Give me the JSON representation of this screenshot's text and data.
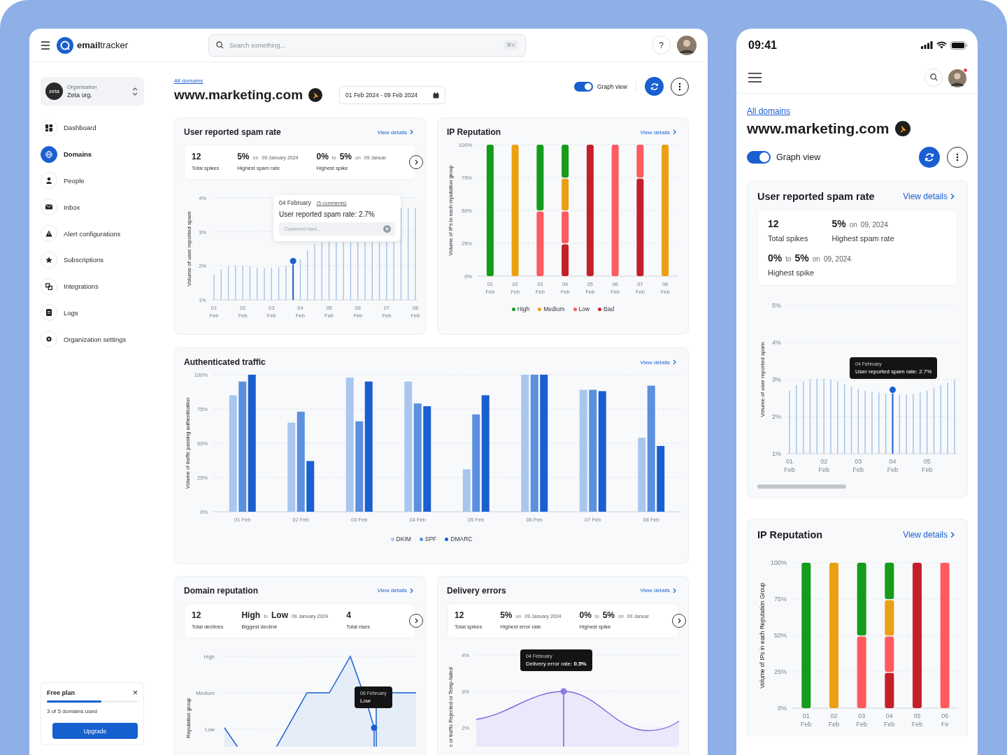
{
  "desktop": {
    "header": {
      "logo": "**email**tracker",
      "search": {
        "placeholder": "Search something...",
        "shortcut": "⌘K"
      },
      "help": "?"
    },
    "sidebar": {
      "org": {
        "badge": "zeta",
        "label": "Organisation",
        "name": "Zeta org."
      },
      "items": [
        {
          "kind": "dashboard",
          "label": "Dashboard",
          "selected": false
        },
        {
          "kind": "domains",
          "label": "Domains",
          "selected": true
        },
        {
          "kind": "people",
          "label": "People",
          "selected": false
        },
        {
          "kind": "inbox",
          "label": "Inbox",
          "selected": false
        },
        {
          "kind": "alerts",
          "label": "Alert configurations",
          "selected": false
        },
        {
          "kind": "subscriptions",
          "label": "Subscriptions",
          "selected": false
        },
        {
          "kind": "integrations",
          "label": "Integrations",
          "selected": false
        },
        {
          "kind": "logs",
          "label": "Logs",
          "selected": false
        },
        {
          "kind": "settings",
          "label": "Organization settings",
          "selected": false
        }
      ],
      "plan": {
        "title": "Free plan",
        "close": "×",
        "level": 0.6,
        "usage": "3 of 5 domains used",
        "button": "Upgrade"
      }
    },
    "page": {
      "breadcrumb": "All domains",
      "title": "www.marketing.com",
      "date_range": "01 Feb 2024 - 09 Feb 2024",
      "graph_view": {
        "label": "Graph view",
        "on": true
      }
    },
    "spam_rate": {
      "title": "User reported spam rate",
      "link": "View details",
      "stats": [
        {
          "parts": [
            {
              "kind": "value",
              "text": "12"
            }
          ],
          "label": "Total spikes"
        },
        {
          "parts": [
            {
              "kind": "value",
              "text": "5%"
            },
            {
              "kind": "note",
              "text": "on"
            },
            {
              "kind": "date",
              "text": "09 January 2024"
            }
          ],
          "label": "Highest spam rate"
        },
        {
          "parts": [
            {
              "kind": "value",
              "text": "0%"
            },
            {
              "kind": "note",
              "text": "to"
            },
            {
              "kind": "value",
              "text": "5%"
            },
            {
              "kind": "note",
              "text": "on"
            },
            {
              "kind": "date",
              "text": "09 Januar"
            }
          ],
          "label": "Highest spike"
        }
      ],
      "tooltip": {
        "date": "04 February",
        "comments": "(5 comments)",
        "text": "User reported spam rate: 2.7%",
        "placeholder": "Comment here..."
      },
      "chart_data": {
        "type": "bar",
        "grid": true,
        "ylabel": "Volume of user reported spam",
        "ylim": [
          1,
          4
        ],
        "yticks": [
          {
            "value": 1,
            "label": "1%"
          },
          {
            "value": 2,
            "label": "2%"
          },
          {
            "value": 3,
            "label": "3%"
          },
          {
            "value": 4,
            "label": "4%"
          }
        ],
        "categories": [
          "01 Feb",
          null,
          null,
          null,
          "02 Feb",
          null,
          null,
          null,
          "03 Feb",
          null,
          null,
          null,
          "04 Feb",
          null,
          null,
          null,
          "05 Feb",
          null,
          null,
          null,
          "06 Feb",
          null,
          null,
          null,
          "07 Feb",
          null,
          null,
          null,
          "08 Feb"
        ],
        "series": [
          {
            "color": "#9ec0ea",
            "values": [
              1.75,
              1.9,
              1.98,
              2,
              2,
              1.98,
              1.95,
              1.94,
              1.95,
              1.96,
              2,
              null,
              2.2,
              2.45,
              2.65,
              2.7,
              2.7,
              2.7,
              2.7,
              2.7,
              2.7,
              2.7,
              2.7,
              2.7,
              2.7,
              2.7,
              3.7,
              3.7,
              3.7
            ]
          },
          {
            "color": "#1a5fd0",
            "values": [
              null,
              null,
              null,
              null,
              null,
              null,
              null,
              null,
              null,
              null,
              null,
              2.04,
              null,
              null,
              null,
              null,
              null,
              null,
              null,
              null,
              null,
              null,
              null,
              null,
              null,
              null,
              null,
              null,
              null
            ]
          }
        ]
      }
    },
    "ip_reputation": {
      "title": "IP Reputation",
      "link": "View details",
      "chart_data": {
        "type": "bar",
        "stacked": true,
        "grid": true,
        "ylabel": "Volume of IPs in each reputation group",
        "ylim": [
          0,
          100
        ],
        "yticks": [
          {
            "value": 0,
            "label": "0%"
          },
          {
            "value": 25,
            "label": "25%"
          },
          {
            "value": 50,
            "label": "50%"
          },
          {
            "value": 75,
            "label": "75%"
          },
          {
            "value": 100,
            "label": "100%"
          }
        ],
        "categories": [
          "01 Feb",
          "02 Feb",
          "03 Feb",
          "04 Feb",
          "05 Feb",
          "06 Feb",
          "07 Feb",
          "08 Feb"
        ],
        "series": [
          {
            "name": "High",
            "color": "#149c1a",
            "values": [
              100,
              0,
              50,
              25,
              0,
              0,
              0,
              0
            ]
          },
          {
            "name": "Medium",
            "color": "#eba012",
            "values": [
              0,
              100,
              0,
              25,
              0,
              0,
              0,
              100
            ]
          },
          {
            "name": "Low",
            "color": "#fe5a5f",
            "values": [
              0,
              0,
              50,
              25,
              0,
              100,
              25,
              0
            ]
          },
          {
            "name": "Bad",
            "color": "#c4202a",
            "values": [
              0,
              0,
              0,
              25,
              100,
              0,
              75,
              0
            ]
          }
        ]
      }
    },
    "authenticated_traffic": {
      "title": "Authenticated traffic",
      "link": "View details",
      "chart_data": {
        "type": "bar",
        "grid": true,
        "ylabel": "Volume of traffic passing authentication",
        "ylim": [
          0,
          100
        ],
        "yticks": [
          {
            "value": 0,
            "label": "0%"
          },
          {
            "value": 25,
            "label": "25%"
          },
          {
            "value": 50,
            "label": "50%"
          },
          {
            "value": 75,
            "label": "75%"
          },
          {
            "value": 100,
            "label": "100%"
          }
        ],
        "categories": [
          "01 Feb",
          "02 Feb",
          "03 Feb",
          "04 Feb",
          "05 Feb",
          "06 Feb",
          "07 Feb",
          "08 Feb"
        ],
        "series": [
          {
            "name": "DKIM",
            "color": "#a9c7ee",
            "values": [
              85,
              65,
              98,
              95,
              31,
              100,
              89,
              54
            ]
          },
          {
            "name": "SPF",
            "color": "#5b8fe0",
            "values": [
              95,
              73,
              66,
              79,
              71,
              100,
              89,
              92
            ]
          },
          {
            "name": "DMARC",
            "color": "#1a5fd0",
            "values": [
              100,
              37,
              95,
              77,
              85,
              100,
              88,
              48
            ]
          }
        ]
      }
    },
    "domain_reputation": {
      "title": "Domain reputation",
      "link": "View details",
      "stats": [
        {
          "parts": [
            {
              "kind": "value",
              "text": "12"
            }
          ],
          "label": "Total declines"
        },
        {
          "parts": [
            {
              "kind": "value",
              "text": "High"
            },
            {
              "kind": "note",
              "text": "to"
            },
            {
              "kind": "value",
              "text": "Low"
            },
            {
              "kind": "date",
              "text": "09 January 2024"
            }
          ],
          "label": "Biggest decline"
        },
        {
          "parts": [
            {
              "kind": "value",
              "text": "4"
            }
          ],
          "label": "Total rises"
        }
      ],
      "y_labels": [
        "High",
        "Medium",
        "Low"
      ],
      "ylabel": "Reputation group",
      "tooltip": {
        "date": "06 February",
        "text": "Low"
      }
    },
    "delivery_errors": {
      "title": "Delivery errors",
      "link": "View details",
      "stats": [
        {
          "parts": [
            {
              "kind": "value",
              "text": "12"
            }
          ],
          "label": "Total spikes"
        },
        {
          "parts": [
            {
              "kind": "value",
              "text": "5%"
            },
            {
              "kind": "note",
              "text": "on"
            },
            {
              "kind": "date",
              "text": "09 January 2024"
            }
          ],
          "label": "Highest error rate"
        },
        {
          "parts": [
            {
              "kind": "value",
              "text": "0%"
            },
            {
              "kind": "note",
              "text": "to"
            },
            {
              "kind": "value",
              "text": "5%"
            },
            {
              "kind": "note",
              "text": "on"
            },
            {
              "kind": "date",
              "text": "09 Januar"
            }
          ],
          "label": "Highest spike"
        }
      ],
      "y_labels": [
        "4%",
        "3%",
        "2%"
      ],
      "ylabel": "e or traffic Rejected or Temp-failed",
      "tooltip": {
        "date": "04 February",
        "text": "Delivery error rate: **0.5%**"
      }
    }
  },
  "mobile": {
    "time": "09:41",
    "breadcrumb": "All domains",
    "title": "www.marketing.com",
    "graph_view": {
      "label": "Graph view",
      "on": true
    },
    "spam_rate": {
      "title": "User reported spam rate",
      "link": "View details",
      "stats": [
        {
          "parts": [
            {
              "kind": "value",
              "text": "12"
            }
          ],
          "label": "Total spikes"
        },
        {
          "parts": [
            {
              "kind": "value",
              "text": "5%"
            },
            {
              "kind": "note",
              "text": "on"
            },
            {
              "kind": "date",
              "text": "09, 2024"
            }
          ],
          "label": "Highest spam rate"
        },
        {
          "parts": [
            {
              "kind": "value",
              "text": "0%"
            },
            {
              "kind": "note",
              "text": "to"
            },
            {
              "kind": "value",
              "text": "5%"
            },
            {
              "kind": "note",
              "text": "on"
            },
            {
              "kind": "date",
              "text": "09, 2024"
            }
          ],
          "label": "Highest spike"
        }
      ],
      "tooltip": {
        "date": "04 February",
        "text": "User reported spam rate: 2.7%"
      },
      "chart_data": {
        "type": "bar",
        "grid": true,
        "ylabel": "Volume of user reported spam",
        "ylim": [
          1,
          5
        ],
        "yticks": [
          {
            "value": 1,
            "label": "1%"
          },
          {
            "value": 2,
            "label": "2%"
          },
          {
            "value": 3,
            "label": "3%"
          },
          {
            "value": 4,
            "label": "4%"
          },
          {
            "value": 5,
            "label": "5%"
          }
        ],
        "categories": [
          "01 Feb",
          null,
          null,
          null,
          null,
          "02 Feb",
          null,
          null,
          null,
          null,
          "03 Feb",
          null,
          null,
          null,
          null,
          "04 Feb",
          null,
          null,
          null,
          null,
          "05 Feb",
          null,
          null,
          null,
          null
        ],
        "series": [
          {
            "color": "#9ec0ea",
            "values": [
              2.7,
              2.85,
              2.95,
              3,
              3.03,
              3.03,
              3,
              2.95,
              2.88,
              2.8,
              2.75,
              2.7,
              2.67,
              2.65,
              2.63,
              null,
              2.6,
              2.6,
              2.62,
              2.65,
              2.7,
              2.78,
              2.85,
              2.92,
              3
            ]
          },
          {
            "color": "#1a5fd0",
            "values": [
              null,
              null,
              null,
              null,
              null,
              null,
              null,
              null,
              null,
              null,
              null,
              null,
              null,
              null,
              null,
              2.63,
              null,
              null,
              null,
              null,
              null,
              null,
              null,
              null,
              null
            ]
          }
        ]
      }
    },
    "ip_reputation": {
      "title": "IP Reputation",
      "link": "View details",
      "chart_data": {
        "type": "bar",
        "stacked": true,
        "grid": true,
        "ylabel": "Volume of IPs in each Reputation Group",
        "ylim": [
          0,
          100
        ],
        "yticks": [
          {
            "value": 0,
            "label": "0%"
          },
          {
            "value": 25,
            "label": "25%"
          },
          {
            "value": 50,
            "label": "50%"
          },
          {
            "value": 75,
            "label": "75%"
          },
          {
            "value": 100,
            "label": "100%"
          }
        ],
        "categories": [
          "01 Feb",
          "02 Feb",
          "03 Feb",
          "04 Feb",
          "05 Feb",
          "06 Fe"
        ],
        "series": [
          {
            "color": "#149c1a",
            "values": [
              100,
              0,
              50,
              25,
              0,
              0
            ]
          },
          {
            "color": "#eba012",
            "values": [
              0,
              100,
              0,
              25,
              0,
              0
            ]
          },
          {
            "color": "#fe5a5f",
            "values": [
              0,
              0,
              50,
              25,
              0,
              100
            ]
          },
          {
            "color": "#c4202a",
            "values": [
              0,
              0,
              0,
              25,
              100,
              0
            ]
          }
        ]
      }
    }
  }
}
